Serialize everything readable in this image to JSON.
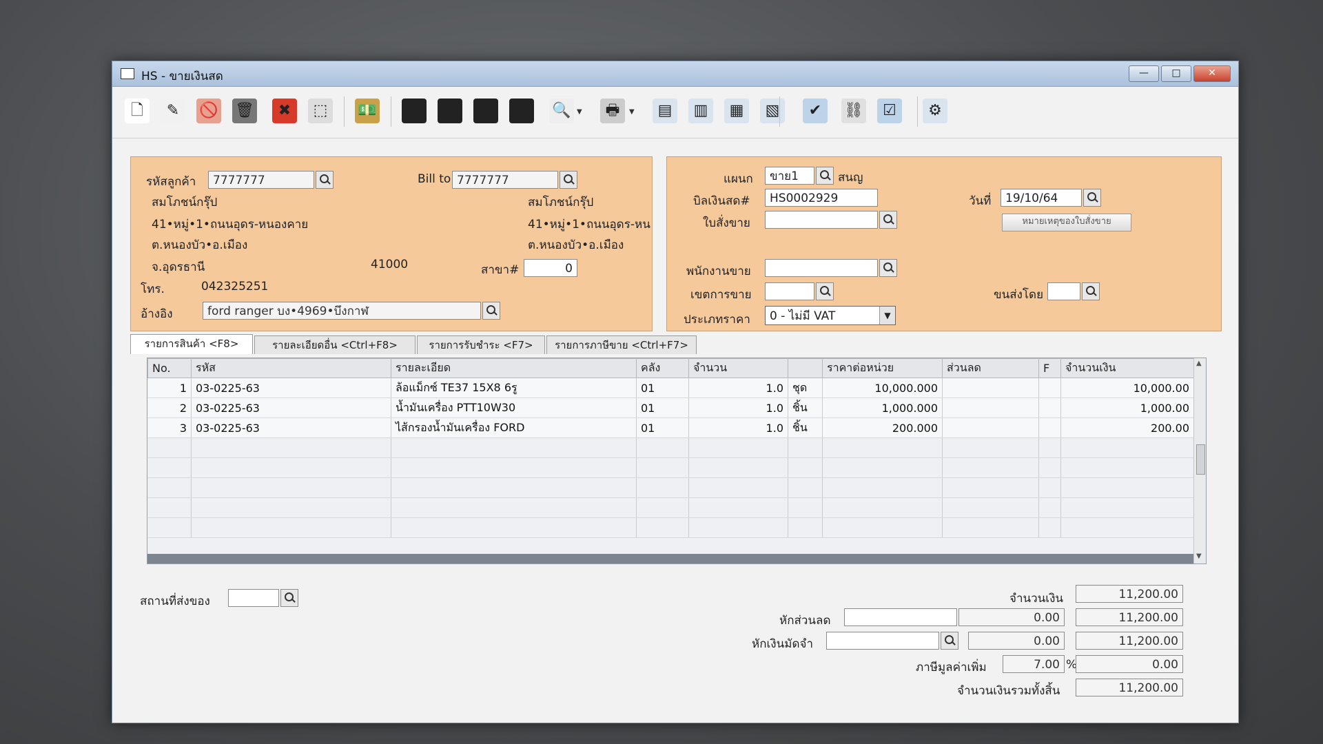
{
  "window": {
    "title": "HS - ขายเงินสด",
    "min": "—",
    "max": "□",
    "close": "✕"
  },
  "toolbar": [
    {
      "name": "new-document-icon",
      "glyph": "🗋"
    },
    {
      "name": "edit-icon",
      "glyph": "✎"
    },
    {
      "name": "void-icon",
      "glyph": "🚫"
    },
    {
      "name": "trash-icon",
      "glyph": "🗑"
    },
    {
      "name": "cancel-icon",
      "glyph": "✖"
    },
    {
      "name": "select-icon",
      "glyph": "⬚"
    },
    {
      "name": "money-icon",
      "glyph": "💵"
    },
    {
      "name": "first-record-icon",
      "glyph": "⏮"
    },
    {
      "name": "prev-record-icon",
      "glyph": "⬅"
    },
    {
      "name": "next-record-icon",
      "glyph": "➡"
    },
    {
      "name": "last-record-icon",
      "glyph": "⏭"
    },
    {
      "name": "preview-icon",
      "glyph": "🔍"
    },
    {
      "name": "print-icon",
      "glyph": "🖶"
    },
    {
      "name": "document-1-icon",
      "glyph": "▤"
    },
    {
      "name": "document-2-icon",
      "glyph": "▥"
    },
    {
      "name": "document-3-icon",
      "glyph": "▦"
    },
    {
      "name": "report-icon",
      "glyph": "▧"
    },
    {
      "name": "approve-icon",
      "glyph": "✔"
    },
    {
      "name": "link-icon",
      "glyph": "⛓"
    },
    {
      "name": "ok-icon",
      "glyph": "☑"
    },
    {
      "name": "settings-icon",
      "glyph": "⚙"
    }
  ],
  "customer": {
    "code_label": "รหัสลูกค้า",
    "code": "7777777",
    "name": "สมโภชน์กรุ๊ป",
    "addr1": "41•หมู่•1•ถนนอุดร-หนองคาย",
    "addr2": "ต.หนองบัว•อ.เมือง",
    "addr3": "จ.อุดรธานี",
    "zip": "41000",
    "phone_label": "โทร.",
    "phone": "042325251",
    "ref_label": "อ้างอิง",
    "ref": "ford ranger บง•4969•บึงกาฬ"
  },
  "billto": {
    "label": "Bill to",
    "code": "7777777",
    "name": "สมโภชน์กรุ๊ป",
    "addr1": "41•หมู่•1•ถนนอุดร-หน",
    "addr2": "ต.หนองบัว•อ.เมือง",
    "branch_label": "สาขา#",
    "branch": "0"
  },
  "doc": {
    "dept_label": "แผนก",
    "dept": "ขาย1",
    "dept_name": "สนญ",
    "bill_label": "บิลเงินสด#",
    "bill": "HS0002929",
    "order_label": "ใบสั่งขาย",
    "order": "",
    "date_label": "วันที่",
    "date": "19/10/64",
    "order_note_button": "หมายเหตุของใบสั่งขาย",
    "salesman_label": "พนักงานขาย",
    "salesman": "",
    "area_label": "เขตการขาย",
    "area": "",
    "ship_label": "ขนส่งโดย",
    "ship": "",
    "pricetype_label": "ประเภทราคา",
    "pricetype": "0 - ไม่มี VAT"
  },
  "tabs": [
    "รายการสินค้า <F8>",
    "รายละเอียดอื่น <Ctrl+F8>",
    "รายการรับชำระ <F7>",
    "รายการภาษีขาย <Ctrl+F7>"
  ],
  "grid": {
    "columns": [
      "No.",
      "รหัส",
      "รายละเอียด",
      "คลัง",
      "จำนวน",
      "",
      "ราคาต่อหน่วย",
      "ส่วนลด",
      "F",
      "จำนวนเงิน"
    ],
    "rows": [
      [
        "1",
        "03-0225-63",
        "ล้อแม็กซ์ TE37 15X8 6รู",
        "01",
        "1.0",
        "ชุด",
        "10,000.000",
        "",
        "",
        "10,000.00"
      ],
      [
        "2",
        "03-0225-63",
        "น้ำมันเครื่อง PTT10W30",
        "01",
        "1.0",
        "ชิ้น",
        "1,000.000",
        "",
        "",
        "1,000.00"
      ],
      [
        "3",
        "03-0225-63",
        "ไส้กรองน้ำมันเครื่อง FORD",
        "01",
        "1.0",
        "ชิ้น",
        "200.000",
        "",
        "",
        "200.00"
      ]
    ]
  },
  "footer": {
    "shipto_label": "สถานที่ส่งของ",
    "shipto": "",
    "amount_label": "จำนวนเงิน",
    "amount": "11,200.00",
    "discount_label": "หักส่วนลด",
    "discount_input": "",
    "discount_value": "0.00",
    "after_discount": "11,200.00",
    "deposit_label": "หักเงินมัดจำ",
    "deposit_input": "",
    "deposit_value": "0.00",
    "after_deposit": "11,200.00",
    "vat_label": "ภาษีมูลค่าเพิ่ม",
    "vat_rate": "7.00",
    "vat_pct": "%",
    "vat_amount": "0.00",
    "total_label": "จำนวนเงินรวมทั้งสิ้น",
    "total": "11,200.00"
  }
}
